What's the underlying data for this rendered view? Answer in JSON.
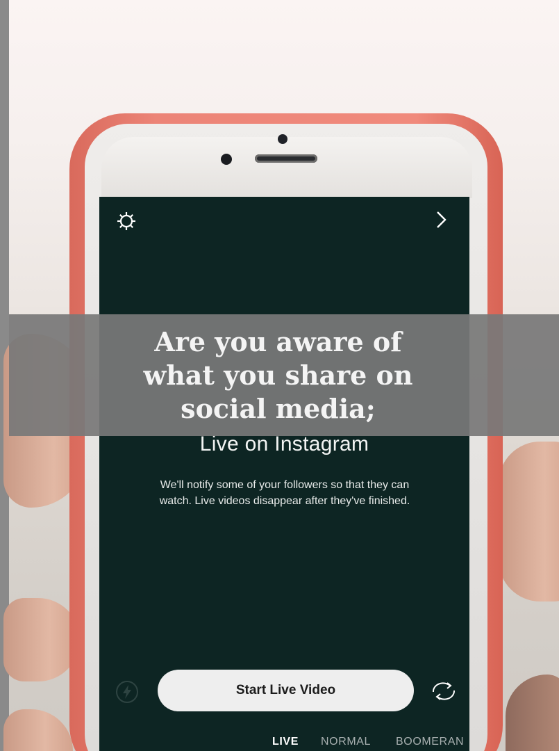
{
  "overlay": {
    "headline_line1": "Are you aware of",
    "headline_line2": "what you share on",
    "headline_line3": "social media;"
  },
  "screen": {
    "title": "Live on Instagram",
    "description": "We'll notify some of your followers so that they can watch. Live videos disappear after they've finished.",
    "start_button_label": "Start Live Video",
    "mode_tabs": [
      "LIVE",
      "NORMAL",
      "BOOMERAN"
    ],
    "active_tab": "LIVE"
  },
  "icons": {
    "top_left": "settings-gear-icon",
    "top_right": "chevron-right-icon",
    "bottom_left": "flash-icon",
    "bottom_right": "switch-camera-icon"
  },
  "colors": {
    "phone_case": "#ee8275",
    "screen_background": "#0d2523",
    "banner_overlay": "#787878",
    "button_background": "#eeeeee"
  }
}
